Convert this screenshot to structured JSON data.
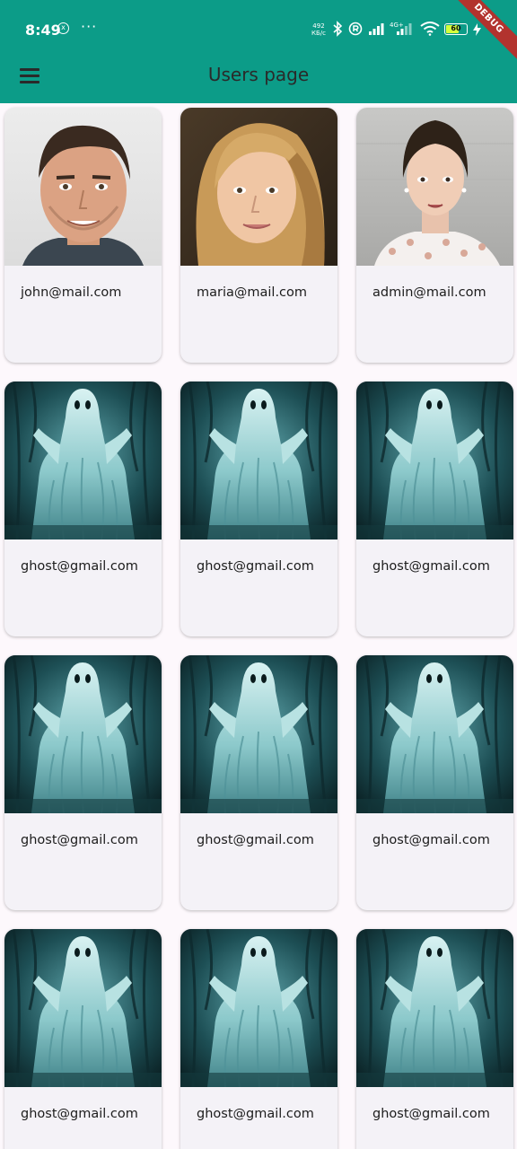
{
  "status_bar": {
    "time": "8:49",
    "notification_icon": "x-circle-icon",
    "overflow": "···",
    "speed_value": "492",
    "speed_unit": "КБ/с",
    "icons": [
      "bluetooth-icon",
      "registered-icon",
      "signal-icon",
      "signal-4g-icon",
      "wifi-icon"
    ],
    "battery": "60",
    "battery_level": 0.6
  },
  "debug_banner": "DEBUG",
  "app_bar": {
    "title": "Users page",
    "menu_icon": "hamburger-menu-icon"
  },
  "colors": {
    "primary": "#0c9c88",
    "card": "#f4f2f7",
    "background": "#fdf8fc"
  },
  "users": [
    {
      "email": "john@mail.com",
      "photo": "man-portrait"
    },
    {
      "email": "maria@mail.com",
      "photo": "blonde-woman-portrait"
    },
    {
      "email": "admin@mail.com",
      "photo": "brunette-woman-portrait"
    },
    {
      "email": "ghost@gmail.com",
      "photo": "ghost-image"
    },
    {
      "email": "ghost@gmail.com",
      "photo": "ghost-image"
    },
    {
      "email": "ghost@gmail.com",
      "photo": "ghost-image"
    },
    {
      "email": "ghost@gmail.com",
      "photo": "ghost-image"
    },
    {
      "email": "ghost@gmail.com",
      "photo": "ghost-image"
    },
    {
      "email": "ghost@gmail.com",
      "photo": "ghost-image"
    },
    {
      "email": "ghost@gmail.com",
      "photo": "ghost-image"
    },
    {
      "email": "ghost@gmail.com",
      "photo": "ghost-image"
    },
    {
      "email": "ghost@gmail.com",
      "photo": "ghost-image"
    }
  ]
}
